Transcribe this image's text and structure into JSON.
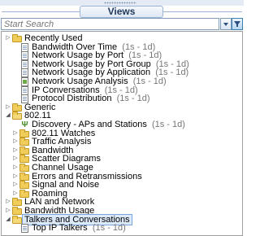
{
  "panel": {
    "title": "Views"
  },
  "search": {
    "placeholder": "Start Search"
  },
  "tree": [
    {
      "label": "Recently Used",
      "range": "",
      "icon": "folder-icon",
      "indent": 0,
      "toggle": "collapsed"
    },
    {
      "label": "Bandwidth Over Time",
      "range": "(1s - 1d)",
      "icon": "document-icon",
      "indent": 1,
      "toggle": "none"
    },
    {
      "label": "Network Usage by Port",
      "range": "(1s - 1d)",
      "icon": "document-icon",
      "indent": 1,
      "toggle": "none"
    },
    {
      "label": "Network Usage by Port Group",
      "range": "(1s - 1d)",
      "icon": "document-icon",
      "indent": 1,
      "toggle": "none"
    },
    {
      "label": "Network Usage by Application",
      "range": "(1s - 1d)",
      "icon": "document-icon",
      "indent": 1,
      "toggle": "none"
    },
    {
      "label": "Network Usage Analysis",
      "range": "(1s - 1d)",
      "icon": "document-green-icon",
      "indent": 1,
      "toggle": "none"
    },
    {
      "label": "IP Conversations",
      "range": "(1s - 1d)",
      "icon": "document-icon",
      "indent": 1,
      "toggle": "none"
    },
    {
      "label": "Protocol Distribution",
      "range": "(1s - 1d)",
      "icon": "document-icon",
      "indent": 1,
      "toggle": "none"
    },
    {
      "label": "Generic",
      "range": "",
      "icon": "folder-icon",
      "indent": 0,
      "toggle": "collapsed"
    },
    {
      "label": "802.11",
      "range": "",
      "icon": "folder-open-icon",
      "indent": 0,
      "toggle": "expanded"
    },
    {
      "label": "Discovery - APs and Stations",
      "range": "(1s - 1d)",
      "icon": "antenna-icon",
      "indent": 1,
      "toggle": "none"
    },
    {
      "label": "802.11 Watches",
      "range": "",
      "icon": "folder-icon",
      "indent": 1,
      "toggle": "collapsed"
    },
    {
      "label": "Traffic Analysis",
      "range": "",
      "icon": "folder-icon",
      "indent": 1,
      "toggle": "collapsed"
    },
    {
      "label": "Bandwidth",
      "range": "",
      "icon": "folder-icon",
      "indent": 1,
      "toggle": "collapsed"
    },
    {
      "label": "Scatter Diagrams",
      "range": "",
      "icon": "folder-icon",
      "indent": 1,
      "toggle": "collapsed"
    },
    {
      "label": "Channel Usage",
      "range": "",
      "icon": "folder-icon",
      "indent": 1,
      "toggle": "collapsed"
    },
    {
      "label": "Errors and Retransmissions",
      "range": "",
      "icon": "folder-icon",
      "indent": 1,
      "toggle": "collapsed"
    },
    {
      "label": "Signal and Noise",
      "range": "",
      "icon": "folder-icon",
      "indent": 1,
      "toggle": "collapsed"
    },
    {
      "label": "Roaming",
      "range": "",
      "icon": "folder-icon",
      "indent": 1,
      "toggle": "collapsed"
    },
    {
      "label": "LAN and Network",
      "range": "",
      "icon": "folder-icon",
      "indent": 0,
      "toggle": "collapsed"
    },
    {
      "label": "Bandwidth Usage",
      "range": "",
      "icon": "folder-icon",
      "indent": 0,
      "toggle": "collapsed"
    },
    {
      "label": "Talkers and Conversations",
      "range": "",
      "icon": "folder-open-icon",
      "indent": 0,
      "toggle": "expanded",
      "selected": true
    },
    {
      "label": "Top IP Talkers",
      "range": "(1s - 1d)",
      "icon": "document-icon",
      "indent": 1,
      "toggle": "none"
    }
  ]
}
